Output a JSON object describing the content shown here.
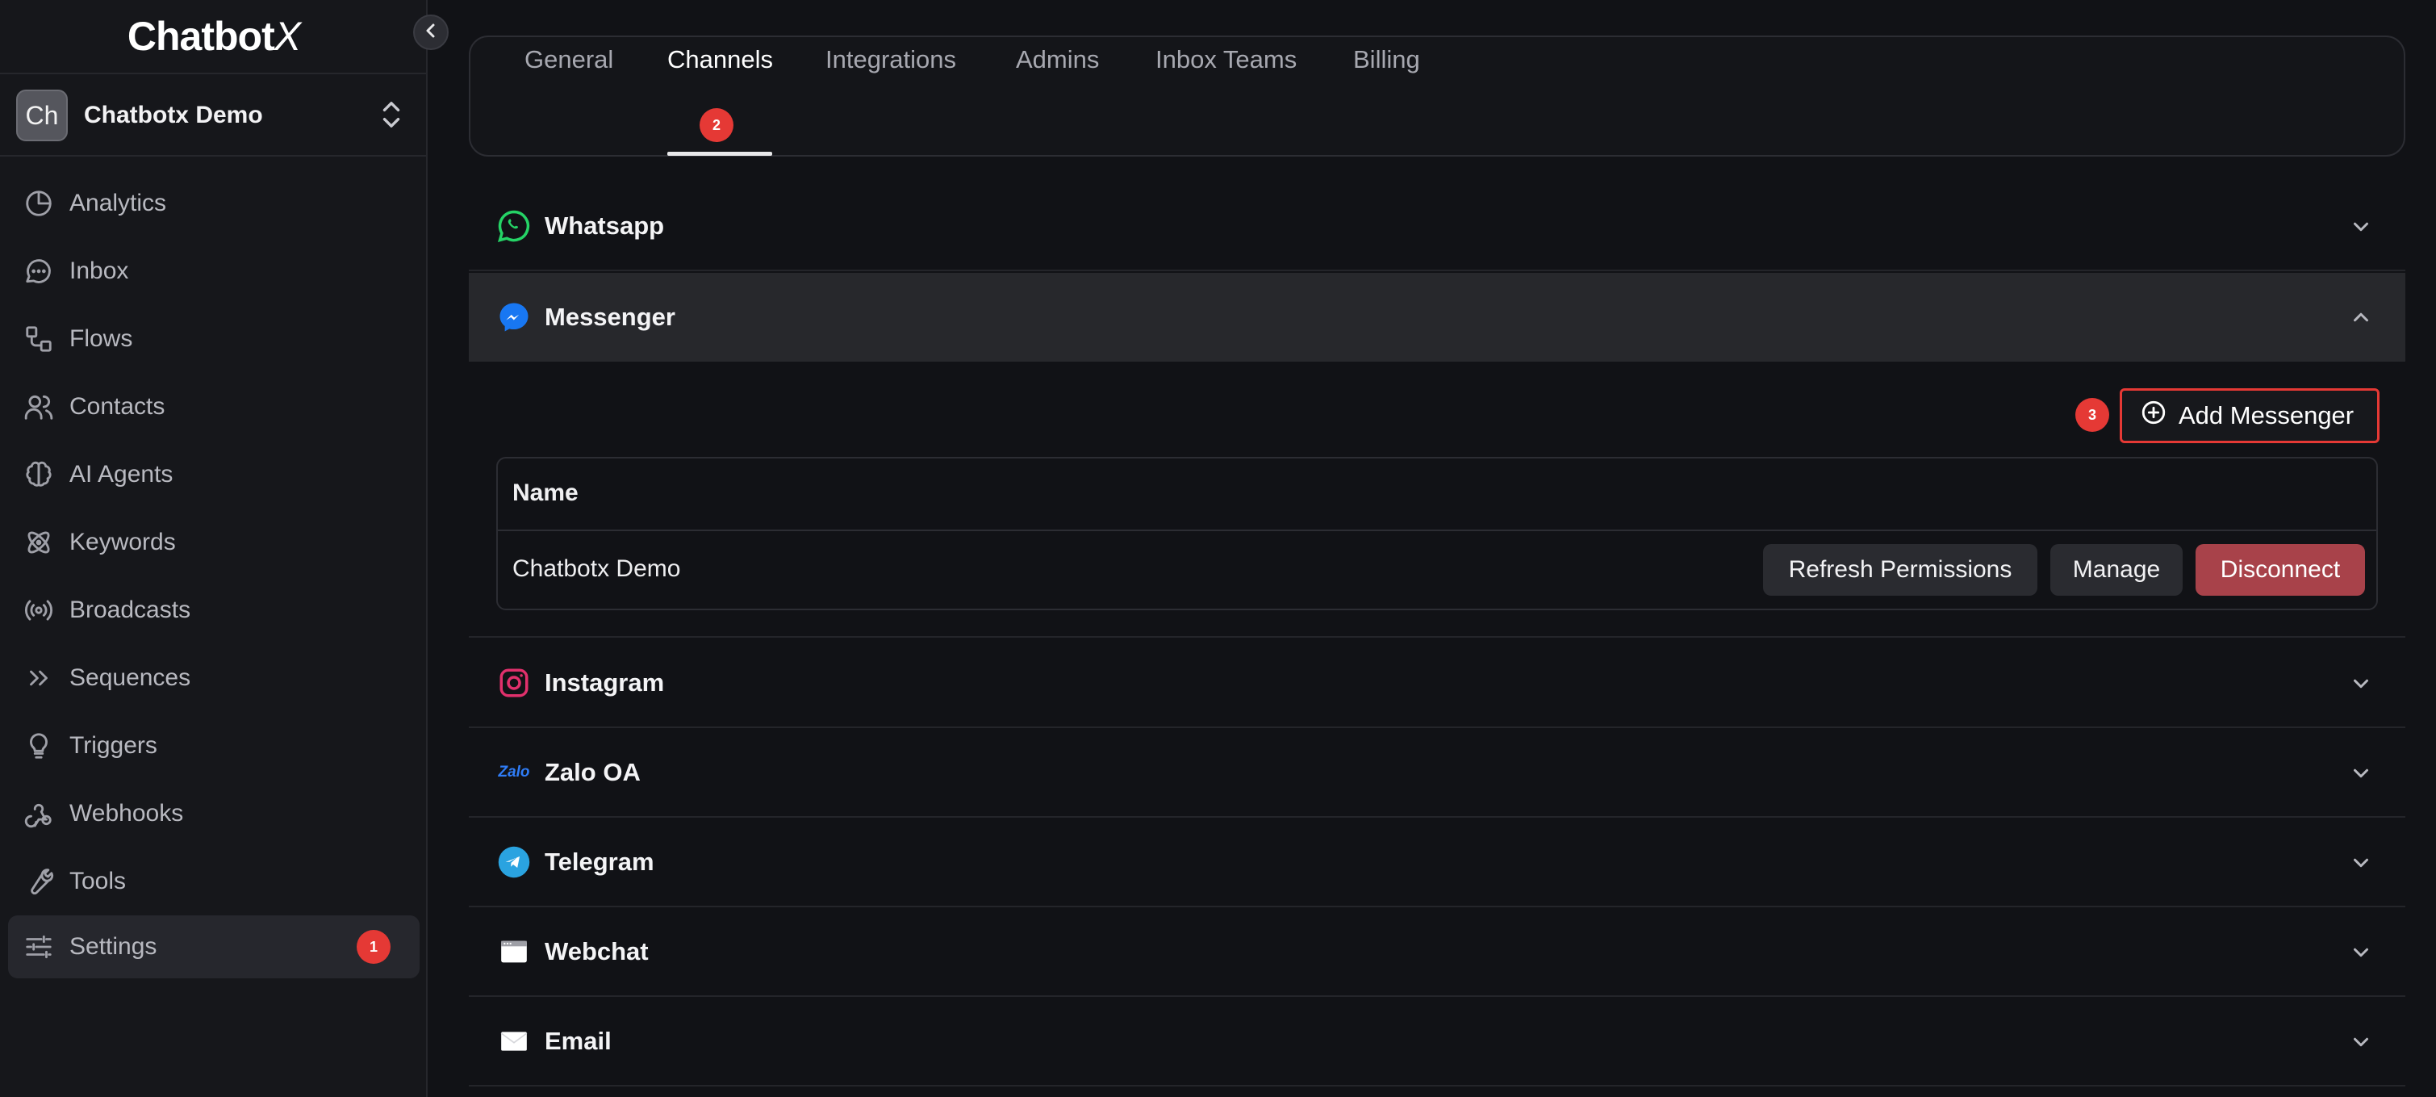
{
  "app": {
    "logo_text": "Chatbot",
    "logo_x": "X"
  },
  "workspace": {
    "avatar": "Ch",
    "name": "Chatbotx Demo"
  },
  "sidebar": {
    "items": [
      {
        "label": "Analytics",
        "icon": "pie-chart-icon"
      },
      {
        "label": "Inbox",
        "icon": "chat-bubble-icon"
      },
      {
        "label": "Flows",
        "icon": "flow-icon"
      },
      {
        "label": "Contacts",
        "icon": "users-icon"
      },
      {
        "label": "AI Agents",
        "icon": "brain-icon"
      },
      {
        "label": "Keywords",
        "icon": "atom-icon"
      },
      {
        "label": "Broadcasts",
        "icon": "broadcast-icon"
      },
      {
        "label": "Sequences",
        "icon": "double-chevron-right-icon"
      },
      {
        "label": "Triggers",
        "icon": "lightbulb-icon"
      },
      {
        "label": "Webhooks",
        "icon": "webhook-icon"
      },
      {
        "label": "Tools",
        "icon": "wrench-icon"
      },
      {
        "label": "Settings",
        "icon": "sliders-icon",
        "badge": "1"
      }
    ]
  },
  "tabs": {
    "items": [
      "General",
      "Channels",
      "Integrations",
      "Admins",
      "Inbox Teams",
      "Billing"
    ],
    "active": "Channels",
    "badge": "2"
  },
  "channels": {
    "whatsapp": "Whatsapp",
    "messenger": "Messenger",
    "instagram": "Instagram",
    "zalo": "Zalo OA",
    "zalo_logo": "Zalo",
    "telegram": "Telegram",
    "webchat": "Webchat",
    "email": "Email"
  },
  "messenger_panel": {
    "add_label": "Add Messenger",
    "add_badge": "3",
    "column_name": "Name",
    "rows": [
      {
        "name": "Chatbotx Demo",
        "refresh": "Refresh Permissions",
        "manage": "Manage",
        "disconnect": "Disconnect"
      }
    ]
  },
  "colors": {
    "background": "#111216",
    "sidebar": "#16171b",
    "badge": "#e53935",
    "disconnect": "#a8424a",
    "whatsapp": "#25d366",
    "messenger": "#1877f2",
    "instagram": "#e1306c",
    "telegram": "#2aa3e0"
  }
}
